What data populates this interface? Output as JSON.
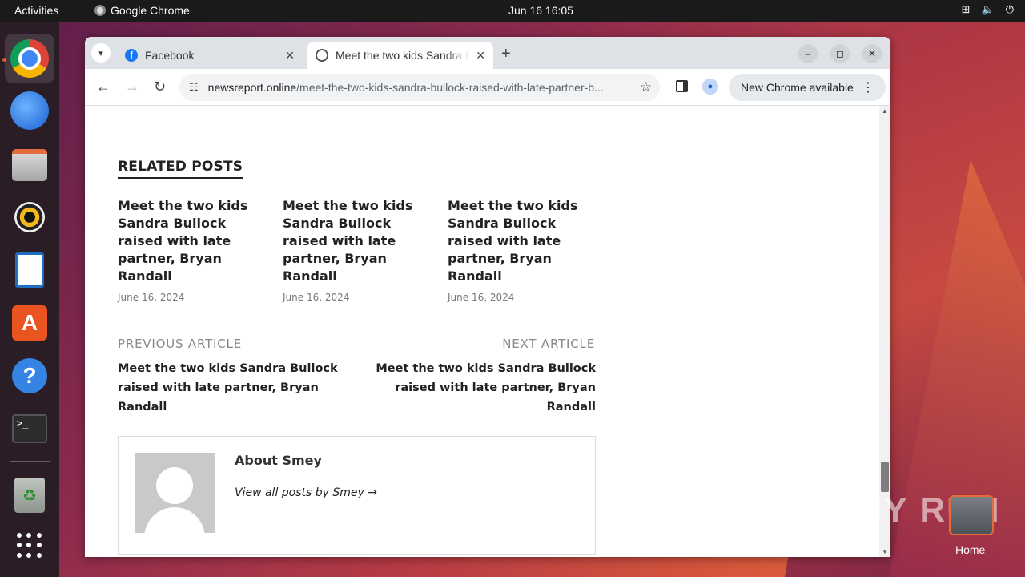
{
  "topbar": {
    "activities": "Activities",
    "app_name": "Google Chrome",
    "clock": "Jun 16  16:05"
  },
  "dock": {
    "items": [
      "Google Chrome",
      "Thunderbird Mail",
      "Files",
      "Rhythmbox",
      "LibreOffice Writer",
      "Ubuntu Software",
      "Help",
      "Terminal",
      "Trash",
      "Show Applications"
    ]
  },
  "browser": {
    "tabs": [
      {
        "title": "Facebook",
        "icon": "facebook-icon"
      },
      {
        "title": "Meet the two kids Sandra Bullock raised with late partner, Bryan Randall",
        "icon": "globe-icon"
      }
    ],
    "url_host": "newsreport.online",
    "url_path": "/meet-the-two-kids-sandra-bullock-raised-with-late-partner-b...",
    "update_label": "New Chrome available"
  },
  "page": {
    "related_heading": "RELATED POSTS",
    "related_posts": [
      {
        "title": "Meet the two kids Sandra Bullock raised with late partner, Bryan Randall",
        "date": "June 16, 2024"
      },
      {
        "title": "Meet the two kids Sandra Bullock raised with late partner, Bryan Randall",
        "date": "June 16, 2024"
      },
      {
        "title": "Meet the two kids Sandra Bullock raised with late partner, Bryan Randall",
        "date": "June 16, 2024"
      }
    ],
    "prev_label": "PREVIOUS ARTICLE",
    "prev_title": "Meet the two kids Sandra Bullock raised with late partner, Bryan Randall",
    "next_label": "NEXT ARTICLE",
    "next_title": "Meet the two kids Sandra Bullock raised with late partner, Bryan Randall",
    "author_heading": "About Smey",
    "author_link": "View all posts by Smey →"
  },
  "desktop": {
    "home_label": "Home",
    "watermark": "ANY RUN"
  },
  "colors": {
    "accent": "#e95420",
    "link_blue": "#1a73e8"
  }
}
